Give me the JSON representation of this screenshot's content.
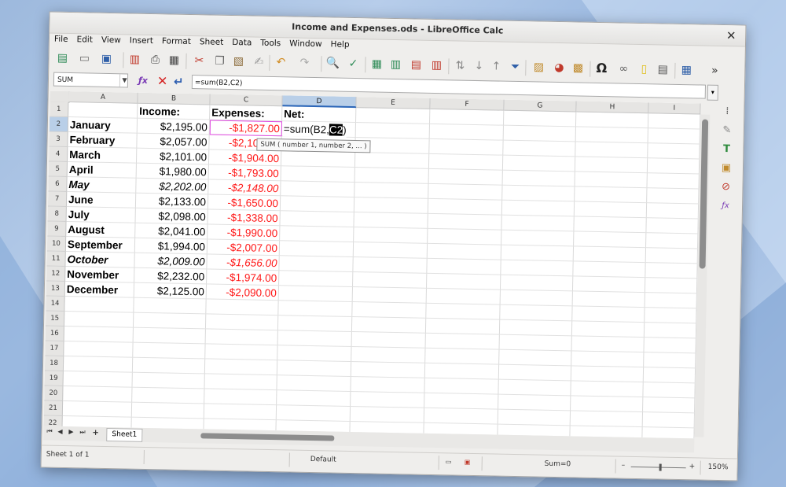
{
  "window": {
    "title": "Income and Expenses.ods - LibreOffice Calc"
  },
  "menu": [
    "File",
    "Edit",
    "View",
    "Insert",
    "Format",
    "Sheet",
    "Data",
    "Tools",
    "Window",
    "Help"
  ],
  "formula_bar": {
    "name_box": "SUM",
    "formula": "=sum(B2,C2)"
  },
  "columns": [
    "A",
    "B",
    "C",
    "D",
    "E",
    "F",
    "G",
    "H",
    "I"
  ],
  "rows": [
    "1",
    "2",
    "3",
    "4",
    "5",
    "6",
    "7",
    "8",
    "9",
    "10",
    "11",
    "12",
    "13",
    "14",
    "15",
    "16",
    "17",
    "18",
    "19",
    "20",
    "21",
    "22"
  ],
  "headers": {
    "a": "",
    "income": "Income:",
    "expenses": "Expenses:",
    "net": "Net:"
  },
  "data": [
    {
      "month": "January",
      "income": "$2,195.00",
      "expense": "-$1,827.00",
      "italic": false
    },
    {
      "month": "February",
      "income": "$2,057.00",
      "expense": "-$2,103.00",
      "italic": false
    },
    {
      "month": "March",
      "income": "$2,101.00",
      "expense": "-$1,904.00",
      "italic": false
    },
    {
      "month": "April",
      "income": "$1,980.00",
      "expense": "-$1,793.00",
      "italic": false
    },
    {
      "month": "May",
      "income": "$2,202.00",
      "expense": "-$2,148.00",
      "italic": true
    },
    {
      "month": "June",
      "income": "$2,133.00",
      "expense": "-$1,650.00",
      "italic": false
    },
    {
      "month": "July",
      "income": "$2,098.00",
      "expense": "-$1,338.00",
      "italic": false
    },
    {
      "month": "August",
      "income": "$2,041.00",
      "expense": "-$1,990.00",
      "italic": false
    },
    {
      "month": "September",
      "income": "$1,994.00",
      "expense": "-$2,007.00",
      "italic": false
    },
    {
      "month": "October",
      "income": "$2,009.00",
      "expense": "-$1,656.00",
      "italic": true
    },
    {
      "month": "November",
      "income": "$2,232.00",
      "expense": "-$1,974.00",
      "italic": false
    },
    {
      "month": "December",
      "income": "$2,125.00",
      "expense": "-$2,090.00",
      "italic": false
    }
  ],
  "editing": {
    "prefix": "=sum(B2,",
    "highlight": "C2",
    "suffix": ")"
  },
  "tooltip": "SUM ( number 1, number 2, ... )",
  "sheet_tab": "Sheet1",
  "status": {
    "sheet": "Sheet 1 of 1",
    "style": "Default",
    "sum": "Sum=0",
    "zoom": "150%",
    "zoom_minus": "–",
    "zoom_plus": "+"
  },
  "colors": {
    "accent": "#2c66b8",
    "negative": "#ff1a1a",
    "ref_border": "#e04be0"
  }
}
